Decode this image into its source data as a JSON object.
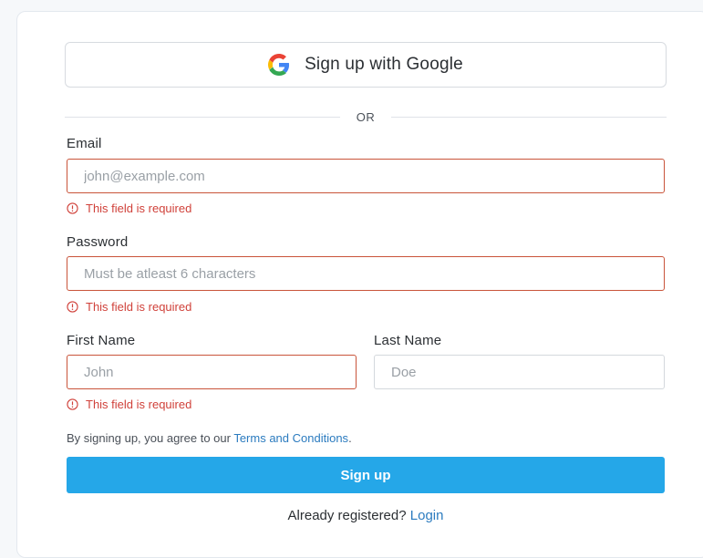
{
  "google_button": {
    "label": "Sign up with Google",
    "icon": "google-g-icon"
  },
  "divider": {
    "label": "OR"
  },
  "email": {
    "label": "Email",
    "placeholder": "john@example.com",
    "value": "",
    "error": "This field is required"
  },
  "password": {
    "label": "Password",
    "placeholder": "Must be atleast 6 characters",
    "value": "",
    "error": "This field is required"
  },
  "first_name": {
    "label": "First Name",
    "placeholder": "John",
    "value": "",
    "error": "This field is required"
  },
  "last_name": {
    "label": "Last Name",
    "placeholder": "Doe",
    "value": ""
  },
  "terms": {
    "prefix": "By signing up, you agree to our ",
    "link": "Terms and Conditions",
    "suffix": "."
  },
  "signup_button": {
    "label": "Sign up"
  },
  "login": {
    "prefix": "Already registered? ",
    "link": "Login"
  },
  "colors": {
    "error": "#d0413a",
    "error_border": "#c9543a",
    "primary": "#25a7e8",
    "link": "#2b7bbf"
  }
}
